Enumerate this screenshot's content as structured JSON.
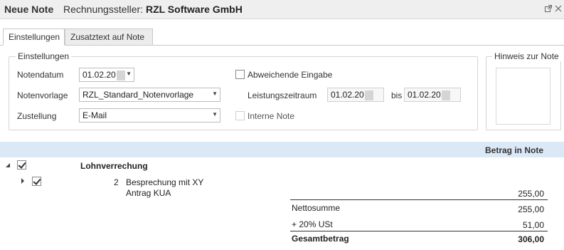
{
  "titlebar": {
    "title": "Neue Note",
    "subtitle_prefix": "Rechnungssteller:",
    "subtitle_company": "RZL Software GmbH"
  },
  "tabs": [
    {
      "label": "Einstellungen",
      "active": true
    },
    {
      "label": "Zusatztext auf Note",
      "active": false
    }
  ],
  "settings": {
    "group_title": "Einstellungen",
    "notendatum_label": "Notendatum",
    "notendatum_value": "01.02.20",
    "notenvorlage_label": "Notenvorlage",
    "notenvorlage_value": "RZL_Standard_Notenvorlage",
    "zustellung_label": "Zustellung",
    "zustellung_value": "E-Mail",
    "abweichende_label": "Abweichende Eingabe",
    "abweichende_checked": false,
    "leistungszeitraum_label": "Leistungszeitraum",
    "leistungszeitraum_from": "01.02.20",
    "bis_label": "bis",
    "leistungszeitraum_to": "01.02.20",
    "interne_label": "Interne Note",
    "interne_checked": false
  },
  "hinweis": {
    "group_title": "Hinweis zur Note"
  },
  "grid": {
    "column_header": "Betrag in Note",
    "group_row": {
      "label": "Lohnverrechung",
      "checked": true
    },
    "item_row": {
      "number": "2",
      "line1": "Besprechung mit XY",
      "line2": "Antrag KUA",
      "checked": true,
      "amount": "255,00"
    }
  },
  "totals": {
    "netto_label": "Nettosumme",
    "netto_value": "255,00",
    "ust_label": "+ 20% USt",
    "ust_value": "51,00",
    "gesamt_label": "Gesamtbetrag",
    "gesamt_value": "306,00"
  },
  "colors": {
    "header_bg": "#dbe9f7",
    "titlebar_bg": "#efefef"
  }
}
